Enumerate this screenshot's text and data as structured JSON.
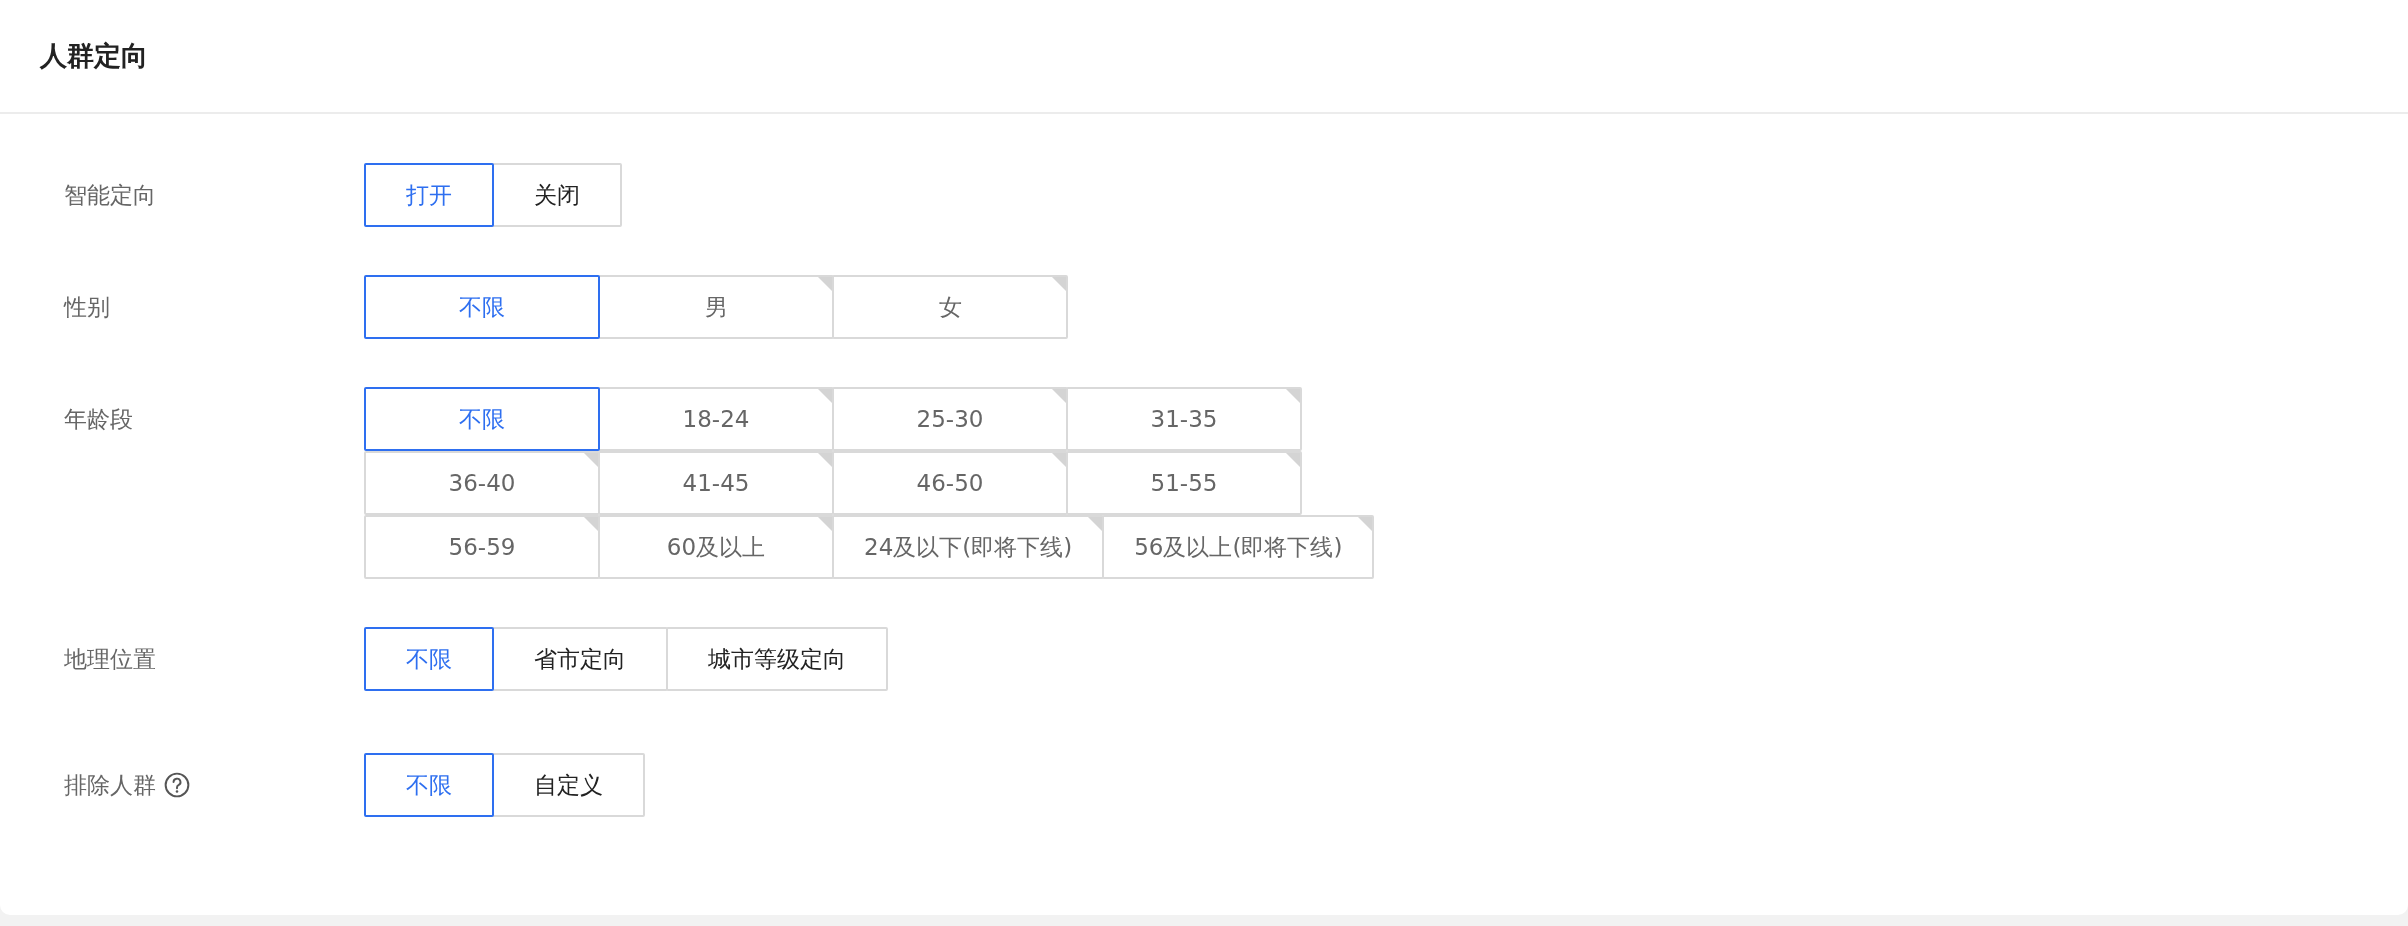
{
  "panel": {
    "title": "人群定向"
  },
  "fields": [
    {
      "label": "智能定向",
      "help": false,
      "kind": "segment",
      "options": [
        {
          "label": "打开",
          "selected": true
        },
        {
          "label": "关闭",
          "selected": false
        }
      ]
    },
    {
      "label": "性别",
      "help": false,
      "kind": "tag",
      "options": [
        {
          "label": "不限",
          "selected": true
        },
        {
          "label": "男",
          "selected": false
        },
        {
          "label": "女",
          "selected": false
        }
      ]
    },
    {
      "label": "年龄段",
      "help": false,
      "kind": "tag",
      "options": [
        {
          "label": "不限",
          "selected": true
        },
        {
          "label": "18-24",
          "selected": false
        },
        {
          "label": "25-30",
          "selected": false
        },
        {
          "label": "31-35",
          "selected": false
        },
        {
          "label": "36-40",
          "selected": false
        },
        {
          "label": "41-45",
          "selected": false
        },
        {
          "label": "46-50",
          "selected": false
        },
        {
          "label": "51-55",
          "selected": false
        },
        {
          "label": "56-59",
          "selected": false
        },
        {
          "label": "60及以上",
          "selected": false
        },
        {
          "label": "24及以下(即将下线)",
          "selected": false
        },
        {
          "label": "56及以上(即将下线)",
          "selected": false
        }
      ]
    },
    {
      "label": "地理位置",
      "help": false,
      "kind": "segment",
      "options": [
        {
          "label": "不限",
          "selected": true
        },
        {
          "label": "省市定向",
          "selected": false
        },
        {
          "label": "城市等级定向",
          "selected": false
        }
      ]
    },
    {
      "label": "排除人群",
      "help": true,
      "kind": "segment",
      "options": [
        {
          "label": "不限",
          "selected": true
        },
        {
          "label": "自定义",
          "selected": false
        }
      ]
    }
  ]
}
